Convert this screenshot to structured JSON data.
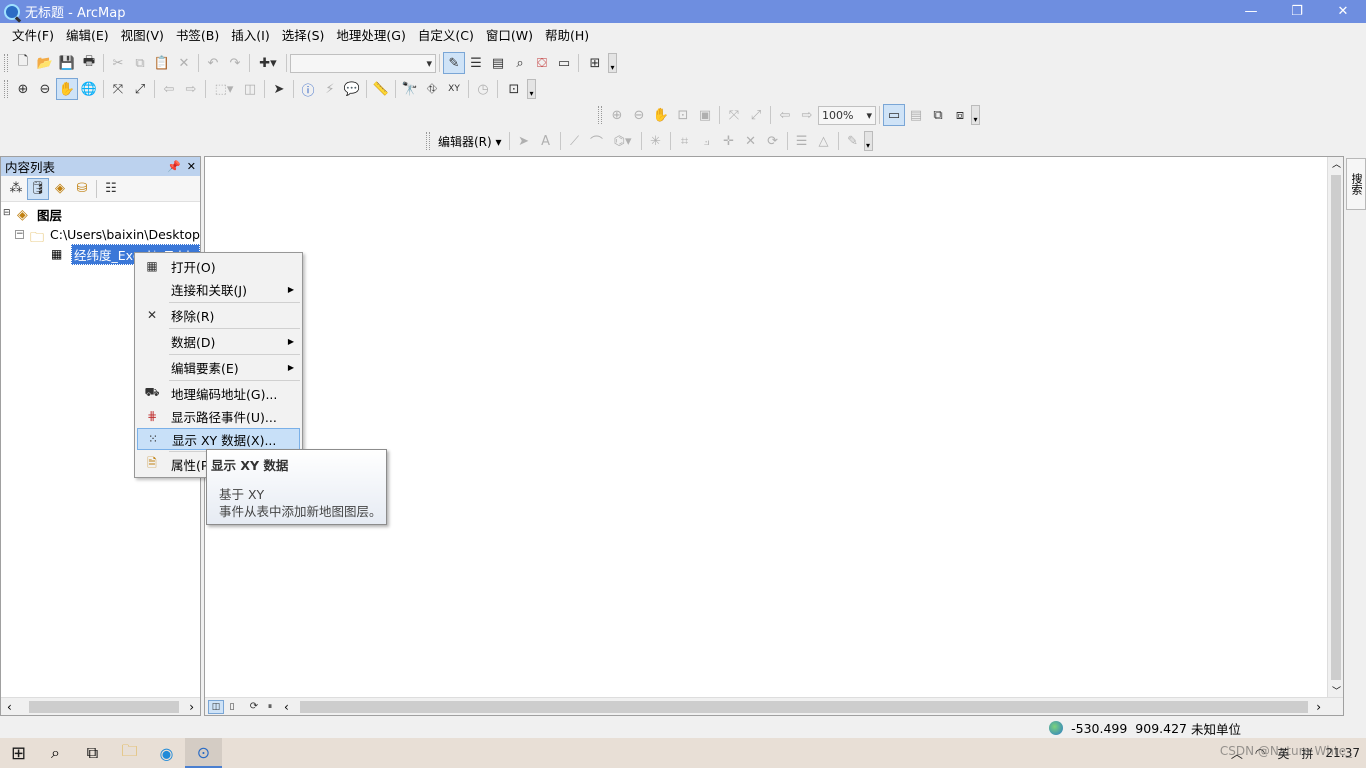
{
  "window": {
    "title": "无标题 - ArcMap",
    "min": "—",
    "restore": "❐",
    "close": "✕"
  },
  "menubar": [
    "文件(F)",
    "编辑(E)",
    "视图(V)",
    "书签(B)",
    "插入(I)",
    "选择(S)",
    "地理处理(G)",
    "自定义(C)",
    "窗口(W)",
    "帮助(H)"
  ],
  "toolbars": {
    "zoom_level": "100%",
    "editor_label": "编辑器(R)"
  },
  "toc": {
    "title": "内容列表",
    "pin": "📌",
    "close": "✕",
    "layers_label": "图层",
    "folder_label": "C:\\Users\\baixin\\Desktop",
    "table_label": "经纬度_Excel$_Table"
  },
  "context_menu": {
    "items": [
      {
        "label": "打开(O)",
        "icon": "table-icon"
      },
      {
        "label": "连接和关联(J)",
        "icon": "",
        "submenu": true
      },
      {
        "label": "移除(R)",
        "icon": "remove-icon"
      },
      {
        "label": "数据(D)",
        "icon": "",
        "submenu": true
      },
      {
        "label": "编辑要素(E)",
        "icon": "",
        "submenu": true
      },
      {
        "label": "地理编码地址(G)...",
        "icon": "geocode-icon"
      },
      {
        "label": "显示路径事件(U)...",
        "icon": "route-event-icon"
      },
      {
        "label": "显示 XY 数据(X)...",
        "icon": "xy-data-icon",
        "highlighted": true
      },
      {
        "label": "属性(P",
        "icon": "properties-icon"
      }
    ]
  },
  "tooltip": {
    "title": "显示 XY 数据",
    "line1": "基于 XY",
    "line2": "事件从表中添加新地图图层。"
  },
  "right_dock": {
    "label": "搜索"
  },
  "status": {
    "x": "-530.499",
    "y": "909.427",
    "units": "未知单位"
  },
  "taskbar": {
    "ime": "英",
    "ime2": "拼",
    "time": "21:37",
    "watermark": "CSDN @Nature Whte_"
  }
}
